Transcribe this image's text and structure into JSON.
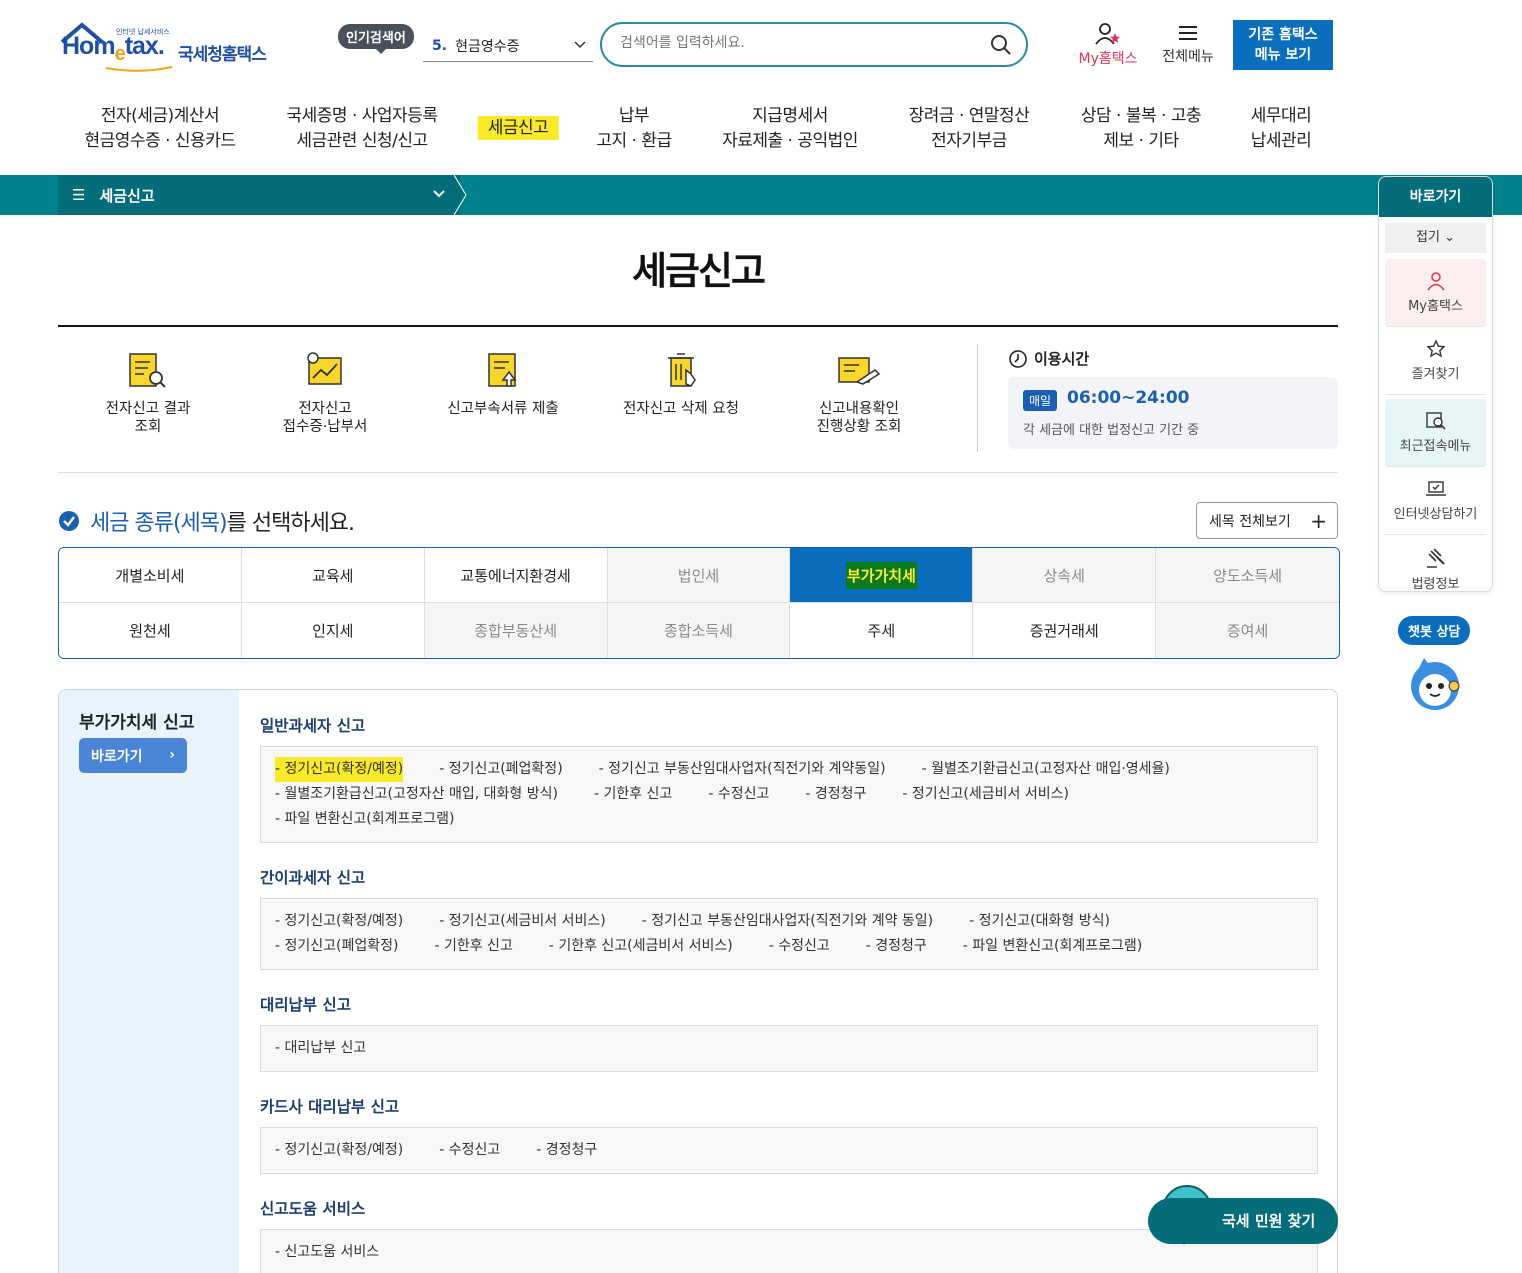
{
  "logo": {
    "small": "인터넷 납세서비스",
    "brand_a": "Hom",
    "brand_e": "e",
    "brand_b": "tax.",
    "kor": "국세청홈택스"
  },
  "header": {
    "popular_badge": "인기검색어",
    "popular_num": "5.",
    "popular_term": "현금영수증",
    "search_placeholder": "검색어를 입력하세요.",
    "myhome": "My홈택스",
    "allmenu": "전체메뉴",
    "old_btn_1": "기존 홈택스",
    "old_btn_2": "메뉴 보기"
  },
  "gnb": [
    {
      "l1": "전자(세금)계산서",
      "l2": "현금영수증 · 신용카드"
    },
    {
      "l1": "국세증명 · 사업자등록",
      "l2": "세금관련 신청/신고"
    },
    {
      "l1": "세금신고",
      "l2": ""
    },
    {
      "l1": "납부",
      "l2": "고지 · 환급"
    },
    {
      "l1": "지급명세서",
      "l2": "자료제출 · 공익법인"
    },
    {
      "l1": "장려금 · 연말정산",
      "l2": "전자기부금"
    },
    {
      "l1": "상담 · 불복 · 고충",
      "l2": "제보 · 기타"
    },
    {
      "l1": "세무대리",
      "l2": "납세관리"
    }
  ],
  "breadcrumb": {
    "label": "세금신고"
  },
  "page_title": "세금신고",
  "quick_links": [
    {
      "l1": "전자신고 결과",
      "l2": "조회"
    },
    {
      "l1": "전자신고",
      "l2": "접수증·납부서"
    },
    {
      "l1": "신고부속서류 제출",
      "l2": ""
    },
    {
      "l1": "전자신고 삭제 요청",
      "l2": ""
    },
    {
      "l1": "신고내용확인",
      "l2": "진행상황 조회"
    }
  ],
  "hours": {
    "title": "이용시간",
    "tag": "매일",
    "time": "06:00~24:00",
    "desc": "각 세금에 대한 법정신고 기간 중"
  },
  "select": {
    "blue": "세금 종류(세목)",
    "rest": "를 선택하세요.",
    "all_btn": "세목 전체보기"
  },
  "taxes": [
    {
      "name": "개별소비세",
      "state": "normal"
    },
    {
      "name": "교육세",
      "state": "normal"
    },
    {
      "name": "교통에너지환경세",
      "state": "normal"
    },
    {
      "name": "법인세",
      "state": "dim"
    },
    {
      "name": "부가가치세",
      "state": "sel"
    },
    {
      "name": "상속세",
      "state": "dim"
    },
    {
      "name": "양도소득세",
      "state": "dim"
    },
    {
      "name": "원천세",
      "state": "normal"
    },
    {
      "name": "인지세",
      "state": "normal"
    },
    {
      "name": "종합부동산세",
      "state": "dim"
    },
    {
      "name": "종합소득세",
      "state": "dim"
    },
    {
      "name": "주세",
      "state": "normal"
    },
    {
      "name": "증권거래세",
      "state": "normal"
    },
    {
      "name": "증여세",
      "state": "dim"
    }
  ],
  "panel": {
    "side_title": "부가가치세 신고",
    "side_btn": "바로가기",
    "sections": [
      {
        "title": "일반과세자 신고",
        "links": [
          "- 정기신고(확정/예정)",
          "- 정기신고(폐업확정)",
          "- 정기신고 부동산임대사업자(직전기와 계약동일)",
          "- 월별조기환급신고(고정자산 매입·영세율)",
          "- 월별조기환급신고(고정자산 매입, 대화형 방식)",
          "- 기한후 신고",
          "- 수정신고",
          "- 경정청구",
          "- 정기신고(세금비서 서비스)",
          "- 파일 변환신고(회계프로그램)"
        ]
      },
      {
        "title": "간이과세자 신고",
        "links": [
          "- 정기신고(확정/예정)",
          "- 정기신고(세금비서 서비스)",
          "- 정기신고 부동산임대사업자(직전기와 계약 동일)",
          "- 정기신고(대화형 방식)",
          "- 정기신고(폐업확정)",
          "- 기한후 신고",
          "- 기한후 신고(세금비서 서비스)",
          "- 수정신고",
          "- 경정청구",
          "- 파일 변환신고(회계프로그램)"
        ]
      },
      {
        "title": "대리납부 신고",
        "links": [
          "- 대리납부 신고"
        ]
      },
      {
        "title": "카드사 대리납부 신고",
        "links": [
          "- 정기신고(확정/예정)",
          "- 수정신고",
          "- 경정청구"
        ]
      },
      {
        "title": "신고도움 서비스",
        "links": [
          "- 신고도움 서비스"
        ]
      }
    ]
  },
  "quickmenu": {
    "title": "바로가기",
    "fold": "접기 ⌄",
    "items": [
      "My홈택스",
      "즐겨찾기",
      "최근접속메뉴",
      "인터넷상담하기",
      "법령정보"
    ]
  },
  "chatbot": "챗봇 상담",
  "civil_btn": "국세 민원 찾기"
}
